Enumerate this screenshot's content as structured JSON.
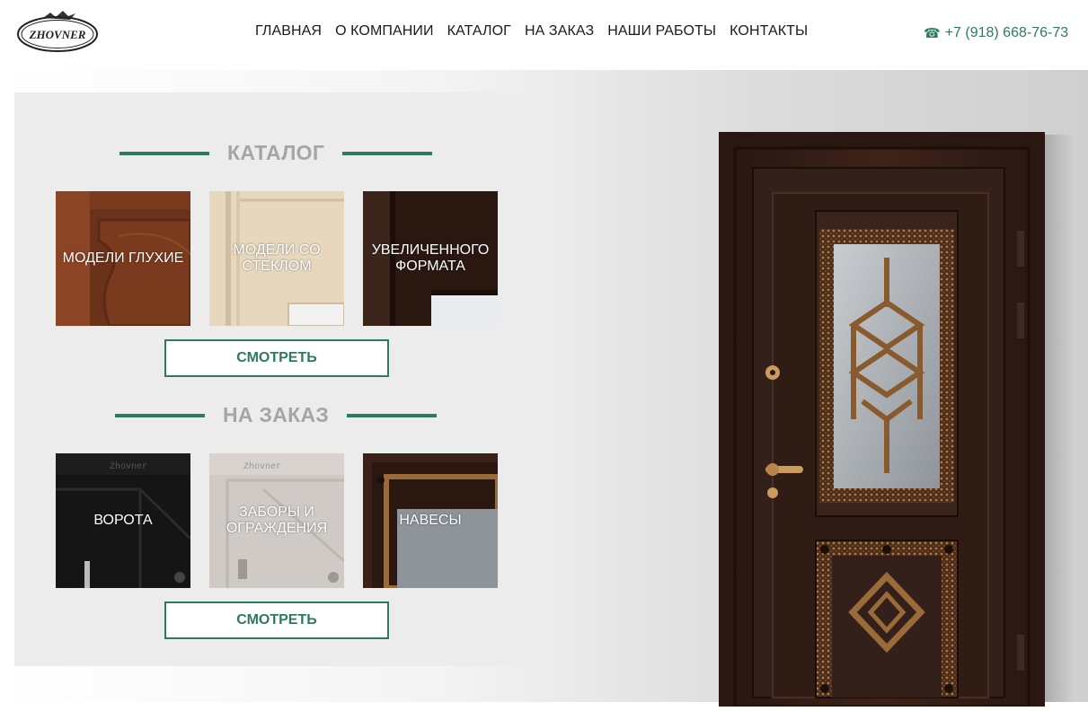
{
  "header": {
    "logo_text": "ZHOVNER",
    "nav": [
      "ГЛАВНАЯ",
      "О КОМПАНИИ",
      "КАТАЛОГ",
      "НА ЗАКАЗ",
      "НАШИ РАБОТЫ",
      "КОНТАКТЫ"
    ],
    "phone": "+7 (918) 668-76-73",
    "phone_icon": "phone-icon"
  },
  "catalog": {
    "title": "КАТАЛОГ",
    "tiles": [
      {
        "label": "МОДЕЛИ ГЛУХИЕ"
      },
      {
        "label": "МОДЕЛИ СО СТЕКЛОМ"
      },
      {
        "label": "УВЕЛИЧЕННОГО ФОРМАТА"
      }
    ],
    "button": "СМОТРЕТЬ"
  },
  "custom": {
    "title": "НА ЗАКАЗ",
    "tiles": [
      {
        "label": "ВОРОТА",
        "engraving": "Zhovner"
      },
      {
        "label": "ЗАБОРЫ И ОГРАЖДЕНИЯ",
        "engraving": "Zhovner"
      },
      {
        "label": "НАВЕСЫ"
      }
    ],
    "button": "СМОТРЕТЬ"
  },
  "colors": {
    "accent": "#2d7a5f",
    "title_gray": "#a5a5a5",
    "panel_bg": "#ececec"
  }
}
